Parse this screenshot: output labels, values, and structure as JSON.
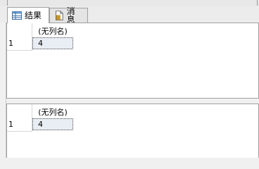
{
  "tabs": [
    {
      "label": "结果",
      "icon": "grid-icon",
      "active": true
    },
    {
      "label": "消息",
      "icon": "document-icon",
      "active": false
    }
  ],
  "result_sets": [
    {
      "column_header": "(无列名)",
      "rows": [
        {
          "row_number": "1",
          "value": "4"
        }
      ]
    },
    {
      "column_header": "(无列名)",
      "rows": [
        {
          "row_number": "1",
          "value": "4"
        }
      ]
    }
  ]
}
